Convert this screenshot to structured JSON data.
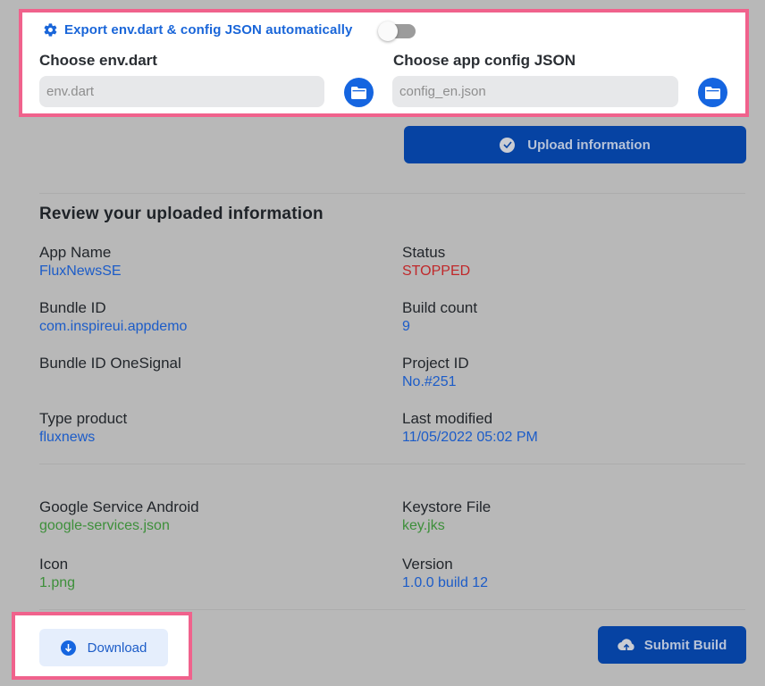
{
  "config_panel": {
    "export_label": "Export env.dart & config JSON automatically",
    "export_toggle_on": false,
    "env_label": "Choose env.dart",
    "env_placeholder": "env.dart",
    "config_label": "Choose app config JSON",
    "config_placeholder": "config_en.json",
    "folder_icon": "folder-icon",
    "gear_icon": "gear-icon"
  },
  "upload_button": {
    "label": "Upload information",
    "icon": "check-circle-icon"
  },
  "review": {
    "title": "Review your uploaded information",
    "left": [
      {
        "label": "App Name",
        "value": "FluxNewsSE",
        "color": "blue"
      },
      {
        "label": "Bundle ID",
        "value": "com.inspireui.appdemo",
        "color": "blue"
      },
      {
        "label": "Bundle ID OneSignal",
        "value": "",
        "color": "blue"
      },
      {
        "label": "Type product",
        "value": "fluxnews",
        "color": "blue"
      }
    ],
    "right": [
      {
        "label": "Status",
        "value": "STOPPED",
        "color": "red"
      },
      {
        "label": "Build count",
        "value": "9",
        "color": "blue"
      },
      {
        "label": "Project ID",
        "value": "No.#251",
        "color": "blue"
      },
      {
        "label": "Last modified",
        "value": "11/05/2022 05:02 PM",
        "color": "blue"
      }
    ]
  },
  "files": {
    "left": [
      {
        "label": "Google Service Android",
        "value": "google-services.json",
        "color": "green"
      },
      {
        "label": "Icon",
        "value": "1.png",
        "color": "green"
      }
    ],
    "right": [
      {
        "label": "Keystore File",
        "value": "key.jks",
        "color": "green"
      },
      {
        "label": "Version",
        "value": "1.0.0 build 12",
        "color": "blue"
      }
    ]
  },
  "actions": {
    "download_label": "Download",
    "download_icon": "arrow-down-circle-icon",
    "submit_label": "Submit Build",
    "submit_icon": "cloud-upload-icon"
  },
  "colors": {
    "accent": "#1565e0",
    "primary_button": "#0643a3",
    "highlight_border": "#f0628c",
    "status_stopped": "#c0282a",
    "file_value": "#3d8f3a"
  }
}
